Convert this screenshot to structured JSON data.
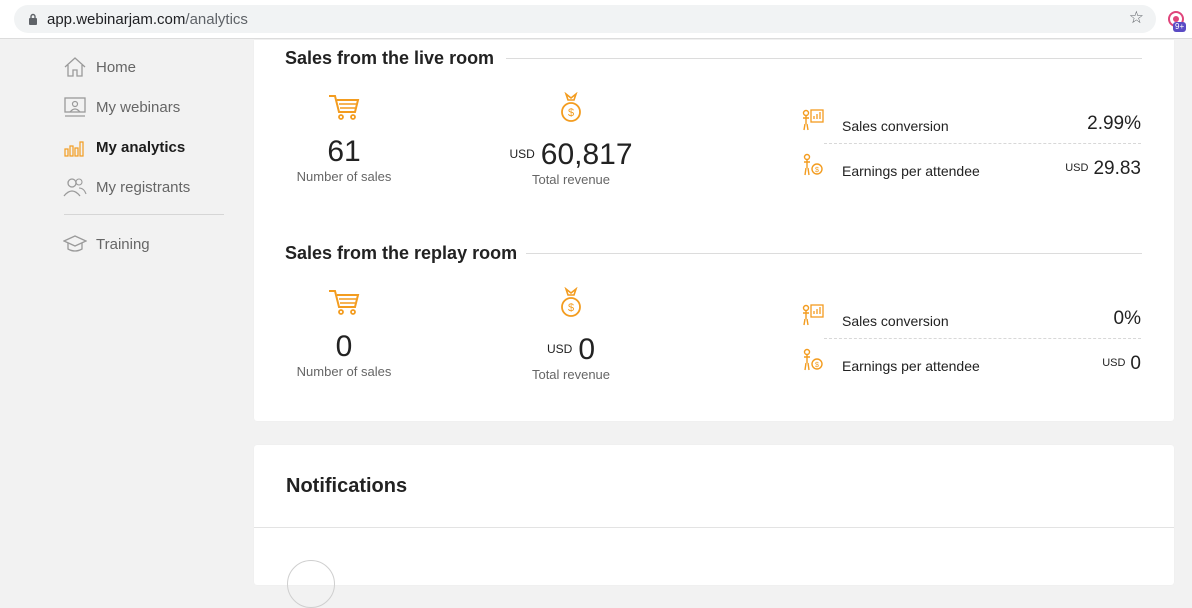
{
  "browser": {
    "url_host": "app.webinarjam.com",
    "url_path": "/analytics",
    "ext_badge": "9+"
  },
  "sidebar": {
    "items": [
      {
        "label": "Home",
        "icon": "house-icon"
      },
      {
        "label": "My webinars",
        "icon": "presenter-icon"
      },
      {
        "label": "My analytics",
        "icon": "bar-chart-icon"
      },
      {
        "label": "My registrants",
        "icon": "users-icon"
      },
      {
        "label": "Training",
        "icon": "graduation-cap-icon"
      }
    ],
    "active_item": "My analytics"
  },
  "live_room": {
    "title": "Sales from the live room",
    "sales_count": "61",
    "sales_label": "Number of sales",
    "revenue_currency": "USD",
    "revenue_value": "60,817",
    "revenue_label": "Total revenue",
    "conversion_label": "Sales conversion",
    "conversion_value": "2.99%",
    "epa_label": "Earnings per attendee",
    "epa_currency": "USD",
    "epa_value": "29.83"
  },
  "replay_room": {
    "title": "Sales from the replay room",
    "sales_count": "0",
    "sales_label": "Number of sales",
    "revenue_currency": "USD",
    "revenue_value": "0",
    "revenue_label": "Total revenue",
    "conversion_label": "Sales conversion",
    "conversion_value": "0%",
    "epa_label": "Earnings per attendee",
    "epa_currency": "USD",
    "epa_value": "0"
  },
  "notifications": {
    "title": "Notifications"
  },
  "colors": {
    "accent": "#f39c1f",
    "muted_icon": "#9a9a9a"
  }
}
